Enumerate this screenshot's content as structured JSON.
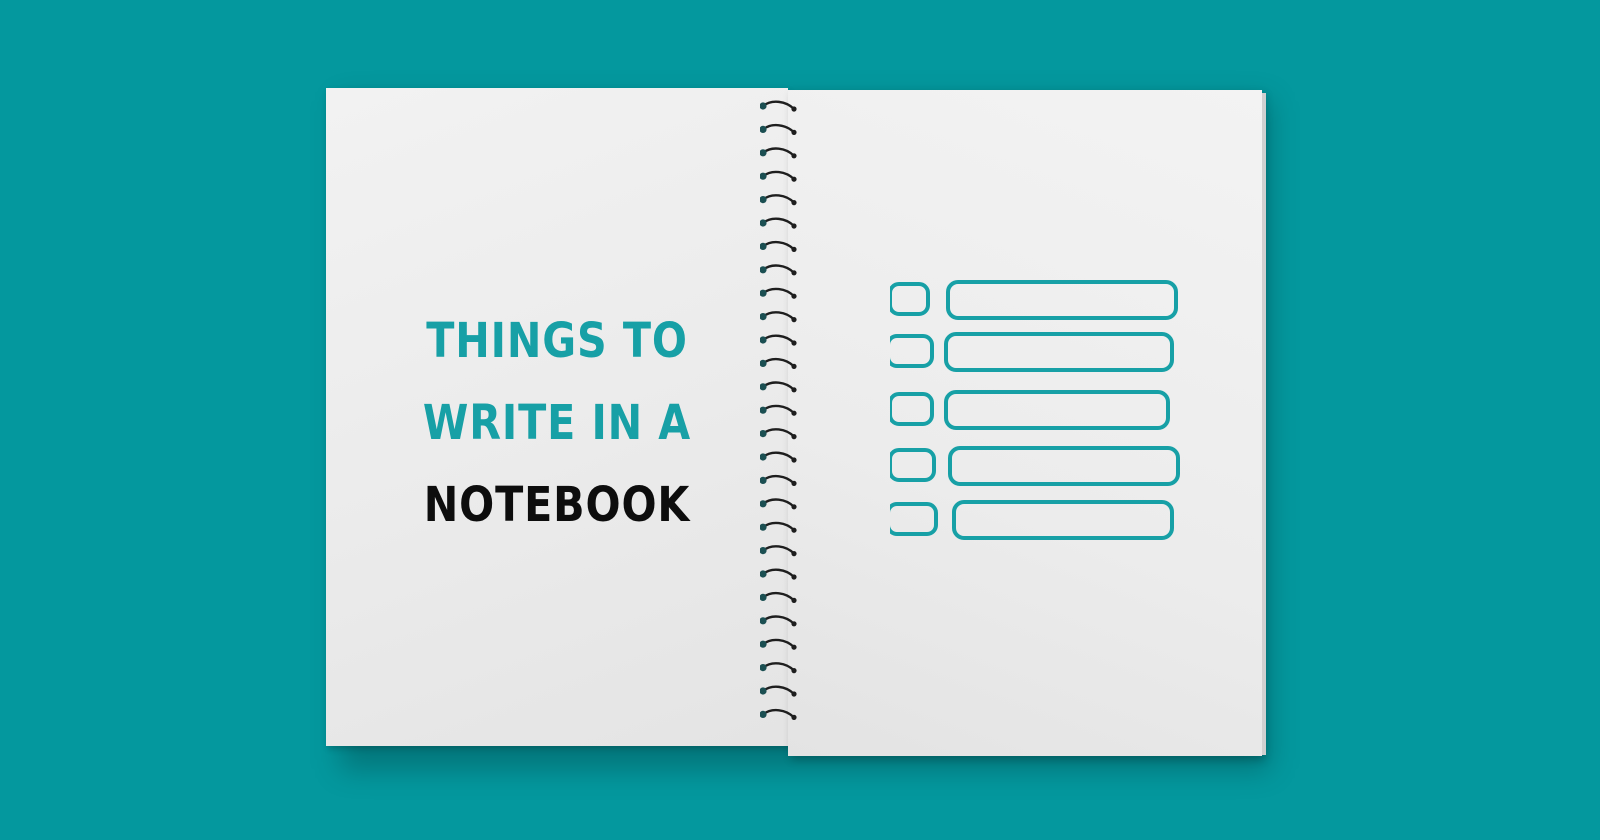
{
  "title": {
    "line1": "THINGS TO",
    "line2": "WRITE IN A",
    "line3": "NOTEBOOK"
  },
  "colors": {
    "background": "#04989e",
    "accent": "#17a0a6",
    "title_dark": "#0d0d0d",
    "page": "#efefef",
    "spiral": "#1e1e1e"
  },
  "icons": {
    "spiral": "spiral-binding-icon",
    "checklist": "checklist-icon"
  },
  "checklist": {
    "rows": 5
  },
  "spiral": {
    "rings": 27
  }
}
